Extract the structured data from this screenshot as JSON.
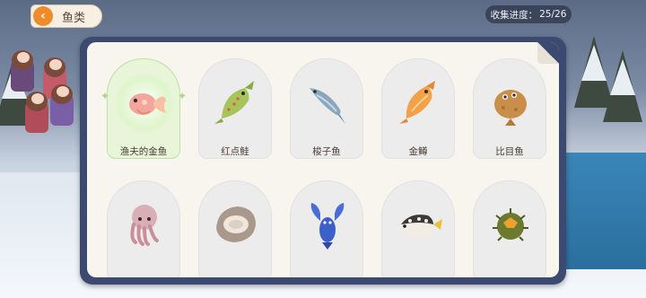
{
  "header": {
    "title": "鱼类",
    "back_icon": "back-arrow-icon"
  },
  "progress": {
    "label": "收集进度：",
    "value": "25/26"
  },
  "colors": {
    "panel_border": "#3c4970",
    "panel_bg": "#f8f5ef",
    "back_button": "#f08b2c",
    "selected_card": "#e9f5d9"
  },
  "fish": [
    {
      "name": "渔夫的金鱼",
      "icon": "pink-goldfish-icon",
      "selected": true
    },
    {
      "name": "红点鲑",
      "icon": "green-trout-icon",
      "selected": false
    },
    {
      "name": "梭子鱼",
      "icon": "blue-pike-icon",
      "selected": false
    },
    {
      "name": "金鳟",
      "icon": "golden-trout-icon",
      "selected": false
    },
    {
      "name": "比目鱼",
      "icon": "flatfish-icon",
      "selected": false
    },
    {
      "name": "",
      "icon": "squid-icon",
      "selected": false
    },
    {
      "name": "",
      "icon": "oyster-icon",
      "selected": false
    },
    {
      "name": "",
      "icon": "blue-lobster-icon",
      "selected": false
    },
    {
      "name": "",
      "icon": "pufferfish-icon",
      "selected": false
    },
    {
      "name": "",
      "icon": "sea-urchin-icon",
      "selected": false
    }
  ]
}
